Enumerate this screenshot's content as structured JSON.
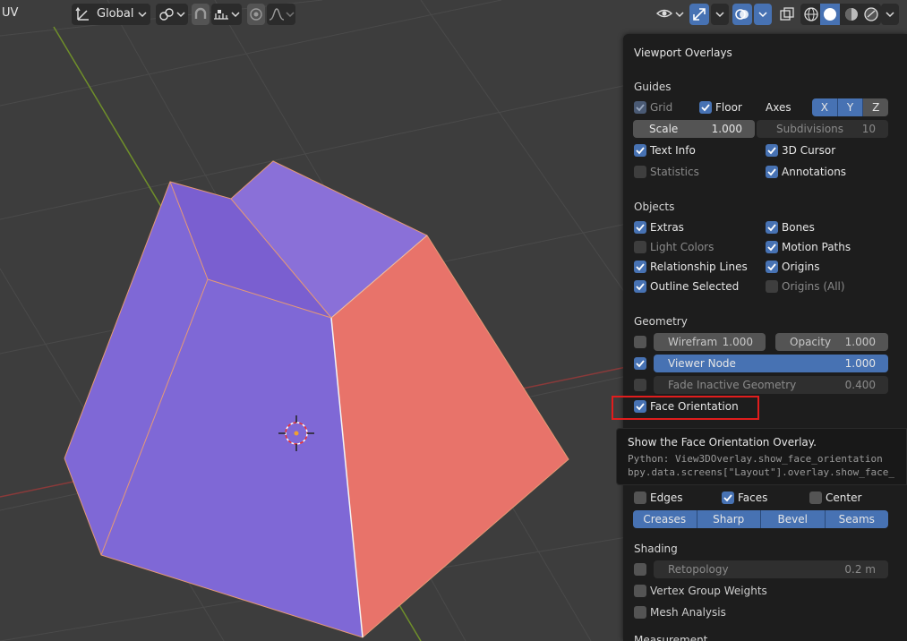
{
  "header": {
    "mode_label": "UV",
    "orientation_label": "Global"
  },
  "overlays": {
    "title": "Viewport Overlays",
    "guides": {
      "heading": "Guides",
      "grid": {
        "label": "Grid",
        "checked": true,
        "enabled": false
      },
      "floor": {
        "label": "Floor",
        "checked": true
      },
      "axes_label": "Axes",
      "axes": [
        "X",
        "Y",
        "Z"
      ],
      "scale": {
        "label": "Scale",
        "value": "1.000"
      },
      "subdivisions": {
        "label": "Subdivisions",
        "value": "10"
      },
      "text_info": {
        "label": "Text Info",
        "checked": true
      },
      "cursor_3d": {
        "label": "3D Cursor",
        "checked": true
      },
      "statistics": {
        "label": "Statistics",
        "checked": false
      },
      "annotations": {
        "label": "Annotations",
        "checked": true
      }
    },
    "objects": {
      "heading": "Objects",
      "extras": {
        "label": "Extras",
        "checked": true
      },
      "bones": {
        "label": "Bones",
        "checked": true
      },
      "light_colors": {
        "label": "Light Colors",
        "checked": false
      },
      "motion_paths": {
        "label": "Motion Paths",
        "checked": true
      },
      "relationship_lines": {
        "label": "Relationship Lines",
        "checked": true
      },
      "origins": {
        "label": "Origins",
        "checked": true
      },
      "outline_selected": {
        "label": "Outline Selected",
        "checked": true
      },
      "origins_all": {
        "label": "Origins (All)",
        "checked": false
      }
    },
    "geometry": {
      "heading": "Geometry",
      "wireframe": {
        "label": "Wirefram",
        "value": "1.000",
        "checked": false
      },
      "opacity": {
        "label": "Opacity",
        "value": "1.000"
      },
      "viewer_node": {
        "label": "Viewer Node",
        "value": "1.000",
        "checked": true
      },
      "fade_inactive": {
        "label": "Fade Inactive Geometry",
        "value": "0.400",
        "checked": false
      },
      "face_orientation": {
        "label": "Face Orientation",
        "checked": true
      }
    },
    "mesh_edit": {
      "edges": {
        "label": "Edges",
        "checked": false
      },
      "faces": {
        "label": "Faces",
        "checked": true
      },
      "center": {
        "label": "Center",
        "checked": false
      },
      "buttons": [
        "Creases",
        "Sharp",
        "Bevel",
        "Seams"
      ]
    },
    "shading": {
      "heading": "Shading",
      "retopology": {
        "label": "Retopology",
        "value": "0.2 m",
        "checked": false
      },
      "vertex_group_weights": {
        "label": "Vertex Group Weights",
        "checked": false
      },
      "mesh_analysis": {
        "label": "Mesh Analysis",
        "checked": false
      }
    },
    "measurement_heading": "Measurement"
  },
  "tooltip": {
    "title": "Show the Face Orientation Overlay.",
    "python_line1": "Python: View3DOverlay.show_face_orientation",
    "python_line2": "bpy.data.screens[\"Layout\"].overlay.show_face_"
  },
  "colors": {
    "front_face": "#7f68d6",
    "back_face": "#e8736a",
    "accent": "#4772b3",
    "highlight": "#e11d1d"
  }
}
